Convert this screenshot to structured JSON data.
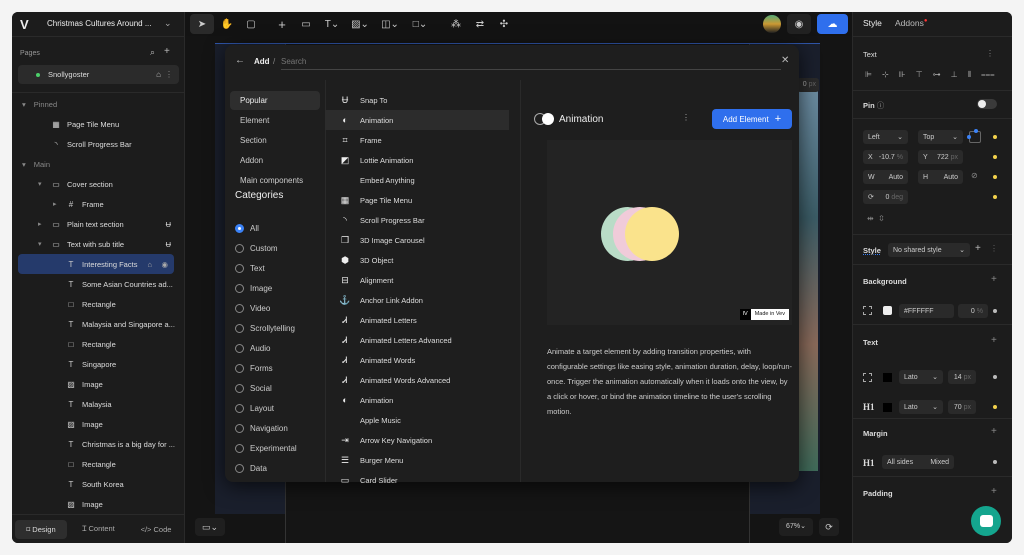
{
  "app": {
    "logo": "V",
    "project_title": "Christmas Cultures Around ..."
  },
  "toolbar": {
    "tools": [
      "pointer-icon",
      "hand-icon",
      "comment-icon",
      "plus-icon",
      "section-icon",
      "text-icon",
      "image-icon",
      "video-icon",
      "shape-icon",
      "components-icon",
      "swap-icon",
      "addon-icon"
    ]
  },
  "pages": {
    "label": "Pages",
    "current": "Snollygoster"
  },
  "layers": {
    "pinned_label": "Pinned",
    "main_label": "Main",
    "items": [
      {
        "label": "Page Tile Menu",
        "icon": "grid-icon",
        "indent": 2
      },
      {
        "label": "Scroll Progress Bar",
        "icon": "progress-icon",
        "indent": 2
      },
      {
        "label": "Cover section",
        "icon": "section-icon",
        "indent": 1
      },
      {
        "label": "Frame",
        "icon": "frame-icon",
        "indent": 2
      },
      {
        "label": "Plain text section",
        "icon": "section-icon",
        "indent": 1
      },
      {
        "label": "Text with sub title",
        "icon": "section-icon",
        "indent": 1
      },
      {
        "label": "Interesting Facts",
        "icon": "text-icon",
        "indent": 3,
        "selected": true
      },
      {
        "label": "Some Asian Countries ad...",
        "icon": "text-icon",
        "indent": 3
      },
      {
        "label": "Rectangle",
        "icon": "rectangle-icon",
        "indent": 3
      },
      {
        "label": "Malaysia and Singapore a...",
        "icon": "text-icon",
        "indent": 3
      },
      {
        "label": "Rectangle",
        "icon": "rectangle-icon",
        "indent": 3
      },
      {
        "label": "Singapore",
        "icon": "text-icon",
        "indent": 3
      },
      {
        "label": "Image",
        "icon": "image-icon",
        "indent": 3
      },
      {
        "label": "Malaysia",
        "icon": "text-icon",
        "indent": 3
      },
      {
        "label": "Image",
        "icon": "image-icon",
        "indent": 3
      },
      {
        "label": "Christmas is a big day for ...",
        "icon": "text-icon",
        "indent": 3
      },
      {
        "label": "Rectangle",
        "icon": "rectangle-icon",
        "indent": 3
      },
      {
        "label": "South Korea",
        "icon": "text-icon",
        "indent": 3
      },
      {
        "label": "Image",
        "icon": "image-icon",
        "indent": 3
      }
    ]
  },
  "bottom_tabs": [
    "Design",
    "Content",
    "Code"
  ],
  "modal": {
    "breadcrumb": "Add",
    "separator": "/",
    "search_placeholder": "Search",
    "sections": [
      "Popular",
      "Element",
      "Section",
      "Addon",
      "Main components"
    ],
    "categories_label": "Categories",
    "categories": [
      "All",
      "Custom",
      "Text",
      "Image",
      "Video",
      "Scrollytelling",
      "Audio",
      "Forms",
      "Social",
      "Layout",
      "Navigation",
      "Experimental",
      "Data"
    ],
    "selected_category": "All",
    "items": [
      "Snap To",
      "Animation",
      "Frame",
      "Lottie Animation",
      "Embed Anything",
      "Page Tile Menu",
      "Scroll Progress Bar",
      "3D Image Carousel",
      "3D Object",
      "Alignment",
      "Anchor Link Addon",
      "Animated Letters",
      "Animated Letters Advanced",
      "Animated Words",
      "Animated Words Advanced",
      "Animation",
      "Apple Music",
      "Arrow Key Navigation",
      "Burger Menu",
      "Card Slider"
    ],
    "selected_item": "Animation",
    "detail": {
      "title": "Animation",
      "add_button": "Add Element",
      "badge_logo": "IV",
      "badge_text": "Made in Vev",
      "description": "Animate a target element by adding transition properties, with configurable settings like easing style, animation duration, delay, loop/run-once. Trigger the animation automatically when it loads onto the view, by a click or hover, or bind the animation timeline to the user's scrolling motion.",
      "circle_colors": [
        "#b9dcc7",
        "#f0cbd9",
        "#fae38c"
      ]
    }
  },
  "canvas": {
    "zoom": "67%",
    "partial_value": "0",
    "partial_unit": "px"
  },
  "right_panel": {
    "tabs": [
      "Style",
      "Addons"
    ],
    "text_label": "Text",
    "pin_label": "Pin",
    "position": {
      "h": "Left",
      "v": "Top"
    },
    "x": {
      "label": "X",
      "value": "-10.7",
      "unit": "%"
    },
    "y": {
      "label": "Y",
      "value": "722",
      "unit": "px"
    },
    "w": {
      "label": "W",
      "value": "Auto"
    },
    "h": {
      "label": "H",
      "value": "Auto"
    },
    "rotation": {
      "value": "0",
      "unit": "deg"
    },
    "style_label": "Style",
    "shared_style": "No shared style",
    "background_label": "Background",
    "bg_color": "#FFFFFF",
    "bg_opacity": "0",
    "bg_unit": "%",
    "text_section_label": "Text",
    "text_rows": [
      {
        "tag": "",
        "font": "Lato",
        "size": "14",
        "unit": "px"
      },
      {
        "tag": "H1",
        "font": "Lato",
        "size": "70",
        "unit": "px"
      }
    ],
    "margin_label": "Margin",
    "margin": {
      "tag": "H1",
      "sides": "All sides",
      "value": "Mixed"
    },
    "padding_label": "Padding"
  },
  "colors": {
    "accent": "#2f6fed",
    "selected_row": "#253a6b",
    "indicator": "#f2d14c",
    "teal": "#14a58e"
  }
}
